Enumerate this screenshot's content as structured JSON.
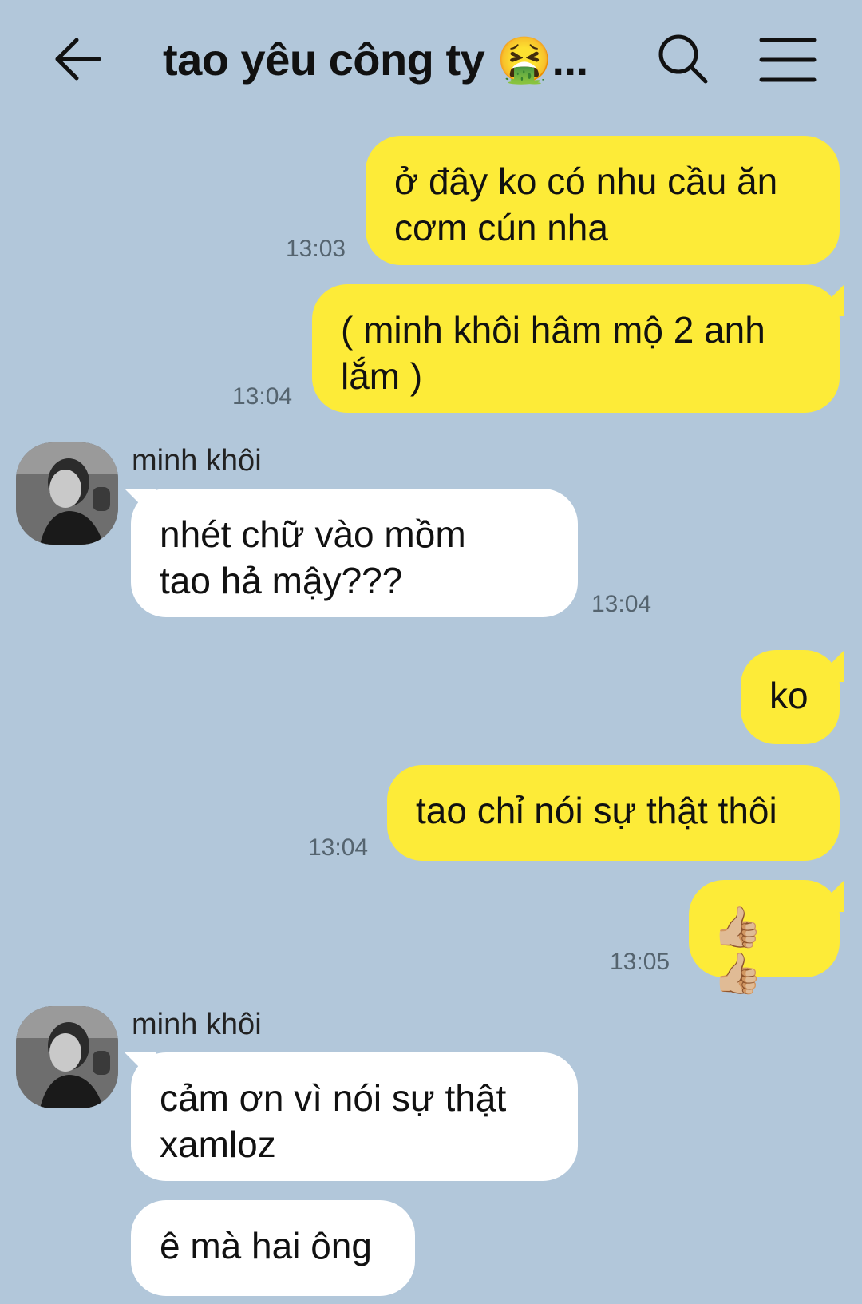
{
  "header": {
    "title": "tao yêu công ty 🤮..."
  },
  "messages": [
    {
      "text": "ở đây ko có nhu cầu ăn\ncơm cún nha",
      "time": "13:03"
    },
    {
      "text": "( minh khôi hâm mộ 2 anh\nlắm )",
      "time": "13:04"
    },
    {
      "sender": "minh khôi",
      "text": "nhét chữ vào mồm\ntao hả mậy???",
      "time": "13:04"
    },
    {
      "text": "ko"
    },
    {
      "text": "tao chỉ nói sự thật thôi",
      "time": "13:04"
    },
    {
      "text": "👍🏼👍🏼",
      "time": "13:05"
    },
    {
      "sender": "minh khôi",
      "text": "cảm ơn vì nói sự thật\nxamloz"
    },
    {
      "text": "ê mà hai ông"
    }
  ],
  "colors": {
    "background": "#b2c7da",
    "outgoing_bubble": "#fdeb38",
    "incoming_bubble": "#ffffff",
    "timestamp": "#55646f"
  }
}
